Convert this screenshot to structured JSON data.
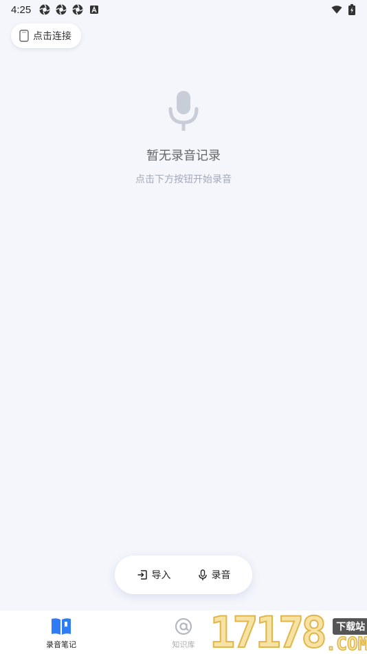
{
  "status_bar": {
    "time": "4:25",
    "left_icons": [
      "aperture-icon",
      "aperture-icon",
      "aperture-icon",
      "a-badge-icon"
    ],
    "right_icons": [
      "wifi-icon",
      "battery-charging-icon"
    ]
  },
  "connect": {
    "label": "点击连接",
    "icon": "device-icon"
  },
  "empty_state": {
    "icon": "microphone-icon",
    "title": "暂无录音记录",
    "subtitle": "点击下方按钮开始录音"
  },
  "actions": {
    "import_label": "导入",
    "record_label": "录音"
  },
  "nav": {
    "items": [
      {
        "label": "录音笔记",
        "icon": "book-open-icon",
        "active": true
      },
      {
        "label": "知识库",
        "icon": "at-sign-icon",
        "active": false
      }
    ]
  },
  "watermark": {
    "digits": "17178",
    "badge": "下载站",
    "com": ".COM"
  },
  "colors": {
    "background": "#f4f6fb",
    "accent": "#2d7cf6",
    "icon_muted": "#c8cdd8"
  }
}
